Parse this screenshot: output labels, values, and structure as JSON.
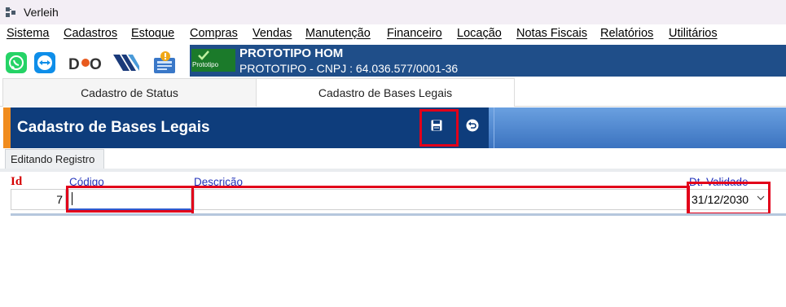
{
  "window": {
    "title": "Verleih"
  },
  "menu": [
    "Sistema",
    "Cadastros",
    "Estoque",
    "Compras",
    "Vendas",
    "Manutenção",
    "Financeiro",
    "Locação",
    "Notas Fiscais",
    "Relatórios",
    "Utilitários"
  ],
  "toolbar": {
    "icons": [
      "whatsapp-icon",
      "teamviewer-icon",
      "dso-logo-icon",
      "stripes-logo-icon",
      "news-alert-icon"
    ]
  },
  "company": {
    "logo_text": "Prototipo",
    "name": "PROTOTIPO HOM",
    "cnpj_line": "PROTOTIPO - CNPJ : 64.036.577/0001-36"
  },
  "tabs": {
    "status": "Cadastro de Status",
    "bases": "Cadastro de Bases Legais"
  },
  "form": {
    "title": "Cadastro de Bases Legais",
    "edit_tab": "Editando Registro",
    "labels": {
      "id": "Id",
      "codigo": "Código",
      "descricao": "Descrição",
      "validade": "Dt. Validade"
    },
    "values": {
      "id": "7",
      "codigo": "",
      "descricao": "",
      "validade": "31/12/2030"
    }
  },
  "colors": {
    "header_blue": "#0e3d7c",
    "company_blue": "#1f4e89",
    "accent_orange": "#f08c1e",
    "highlight_red": "#e2001a",
    "label_blue": "#2233bb",
    "label_red": "#d60000"
  }
}
